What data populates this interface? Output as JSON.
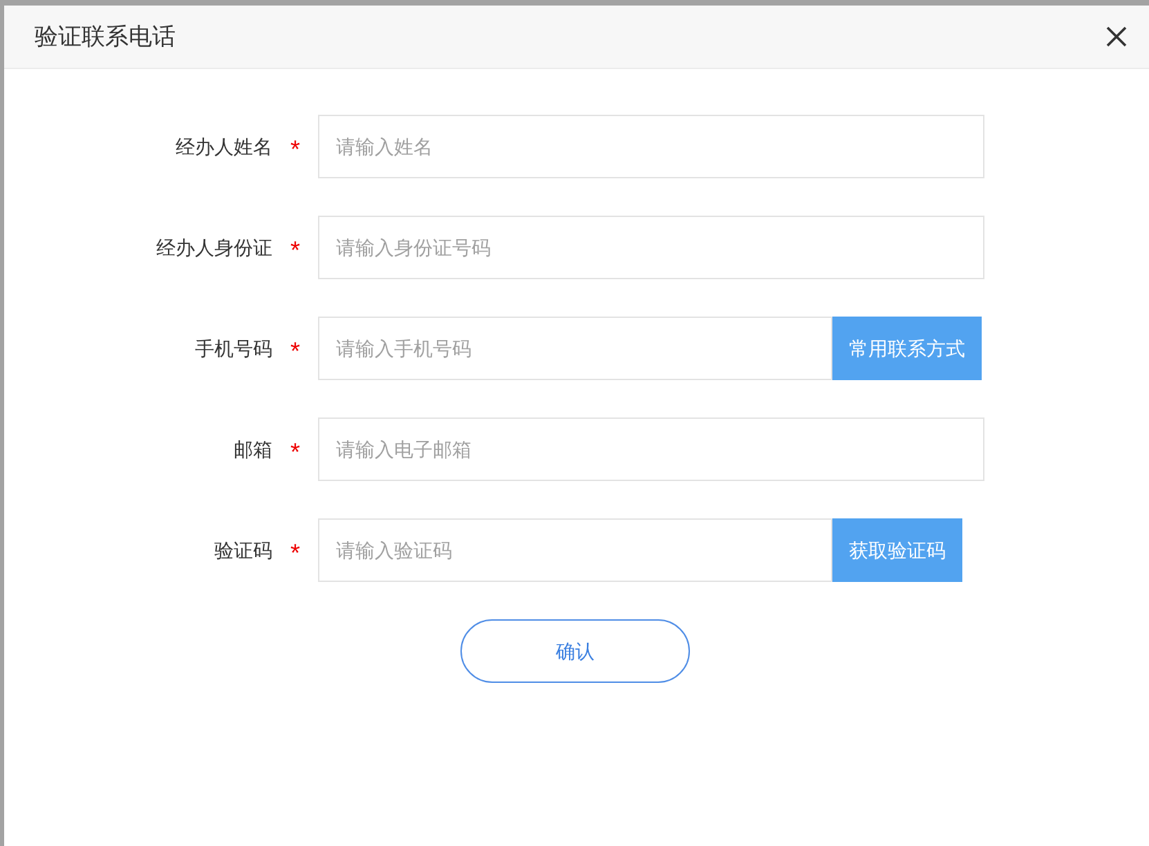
{
  "dialog": {
    "title": "验证联系电话"
  },
  "fields": [
    {
      "label": "经办人姓名",
      "required_mark": "*",
      "placeholder": "请输入姓名"
    },
    {
      "label": "经办人身份证",
      "required_mark": "*",
      "placeholder": "请输入身份证号码"
    },
    {
      "label": "手机号码",
      "required_mark": "*",
      "placeholder": "请输入手机号码",
      "button": "常用联系方式"
    },
    {
      "label": "邮箱",
      "required_mark": "*",
      "placeholder": "请输入电子邮箱"
    },
    {
      "label": "验证码",
      "required_mark": "*",
      "placeholder": "请输入验证码",
      "button": "获取验证码"
    }
  ],
  "confirm_button": "确认"
}
